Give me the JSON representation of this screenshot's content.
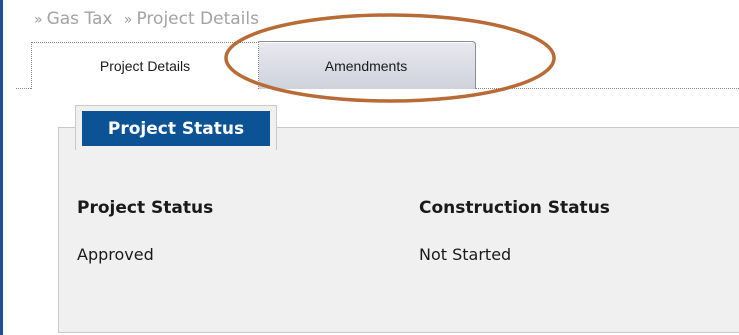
{
  "breadcrumb": {
    "items": [
      "Gas Tax",
      "Project Details"
    ],
    "separator": "»"
  },
  "tabs": [
    {
      "label": "Project Details",
      "selected": true
    },
    {
      "label": "Amendments",
      "selected": false
    }
  ],
  "section": {
    "title": "Project Status",
    "fields": [
      {
        "label": "Project Status",
        "value": "Approved"
      },
      {
        "label": "Construction Status",
        "value": "Not Started"
      }
    ]
  },
  "colors": {
    "accent": "#0b5394",
    "annotation": "#b86b35",
    "panel_bg": "#f0f0f0"
  }
}
